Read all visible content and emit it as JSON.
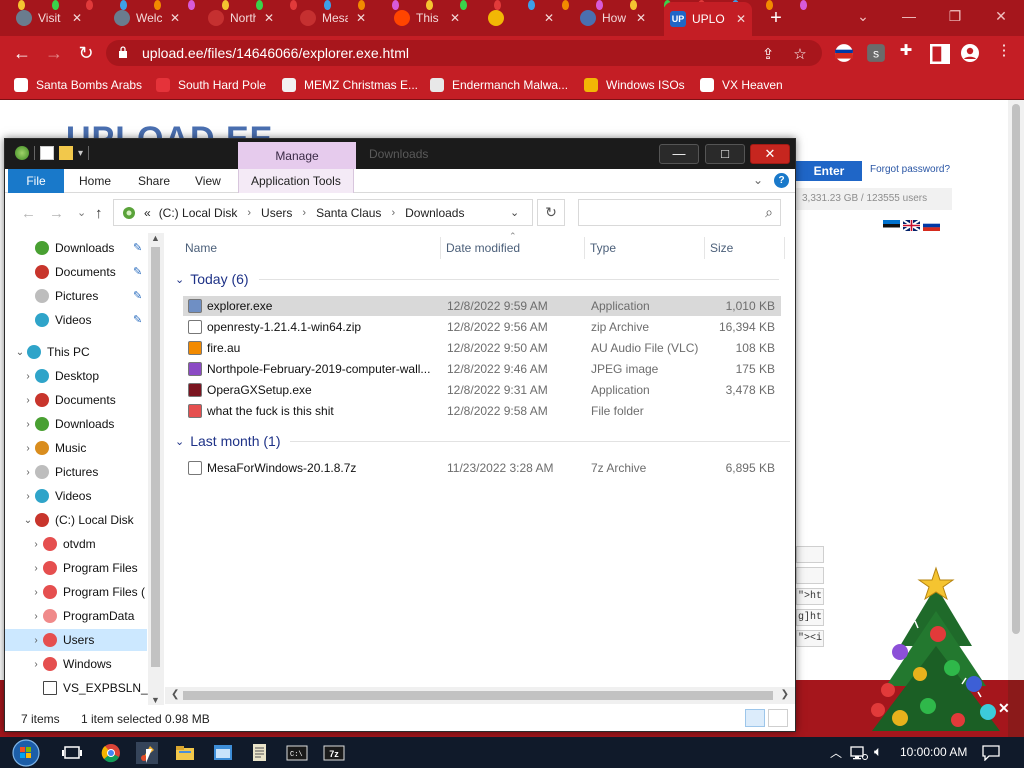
{
  "browser": {
    "tabs": [
      {
        "label": "Visit",
        "color": "#6a7c8e"
      },
      {
        "label": "Welc",
        "color": "#6a7c8e"
      },
      {
        "label": "North",
        "color": "#c53030"
      },
      {
        "label": "Mesa",
        "color": "#c53030"
      },
      {
        "label": "This",
        "color": "#ff4500"
      },
      {
        "label": "",
        "color": "#f2b705"
      },
      {
        "label": "How",
        "color": "#4a6fb0"
      },
      {
        "label": "UPLO",
        "color": "#1f66c7",
        "icon": "UP",
        "active": true
      }
    ],
    "url": "upload.ee/files/14646066/explorer.exe.html",
    "bookmarks": [
      {
        "label": "Santa Bombs Arabs",
        "color": "#ffffff"
      },
      {
        "label": "South Hard Pole",
        "color": "#e5333a"
      },
      {
        "label": "MEMZ Christmas E...",
        "color": "#f2f2f2"
      },
      {
        "label": "Endermanch Malwa...",
        "color": "#e8e8e8"
      },
      {
        "label": "Windows ISOs",
        "color": "#f2b705"
      },
      {
        "label": "VX Heaven",
        "color": "#ffffff"
      }
    ]
  },
  "webpage": {
    "logo": "UPLOAD.EE",
    "enter": "Enter",
    "forgot": "Forgot password?",
    "stats": "3,331.23 GB  /  123555 users",
    "codes": [
      "",
      "",
      "\">htt",
      "g]http",
      "\"><i"
    ]
  },
  "explorer": {
    "title": "Downloads",
    "manage": "Manage",
    "ribbon_tabs": [
      "File",
      "Home",
      "Share",
      "View",
      "Application Tools"
    ],
    "breadcrumb": [
      "(C:) Local Disk",
      "Users",
      "Santa Claus",
      "Downloads"
    ],
    "breadcrumb_lead": "«",
    "search_placeholder": "",
    "columns": {
      "name": "Name",
      "date": "Date modified",
      "type": "Type",
      "size": "Size"
    },
    "nav": [
      {
        "label": "Downloads",
        "indent": 1,
        "color": "#49a032",
        "pin": true
      },
      {
        "label": "Documents",
        "indent": 1,
        "color": "#c8352c",
        "pin": true
      },
      {
        "label": "Pictures",
        "indent": 1,
        "color": "#bdbdbd",
        "pin": true
      },
      {
        "label": "Videos",
        "indent": 1,
        "color": "#2fa4c9",
        "pin": true
      },
      {
        "label": "This PC",
        "indent": 0,
        "color": "#2fa4c9",
        "expanded": true,
        "gap": true
      },
      {
        "label": "Desktop",
        "indent": 1,
        "color": "#2fa4c9",
        "arrow": true
      },
      {
        "label": "Documents",
        "indent": 1,
        "color": "#c8352c",
        "arrow": true
      },
      {
        "label": "Downloads",
        "indent": 1,
        "color": "#49a032",
        "arrow": true
      },
      {
        "label": "Music",
        "indent": 1,
        "color": "#d98d1e",
        "arrow": true
      },
      {
        "label": "Pictures",
        "indent": 1,
        "color": "#bdbdbd",
        "arrow": true
      },
      {
        "label": "Videos",
        "indent": 1,
        "color": "#2fa4c9",
        "arrow": true
      },
      {
        "label": "(C:) Local Disk",
        "indent": 1,
        "color": "#c8352c",
        "expanded": true
      },
      {
        "label": "otvdm",
        "indent": 2,
        "color": "#e54f4f",
        "arrow": true
      },
      {
        "label": "Program Files",
        "indent": 2,
        "color": "#e54f4f",
        "arrow": true
      },
      {
        "label": "Program Files (",
        "indent": 2,
        "color": "#e54f4f",
        "arrow": true
      },
      {
        "label": "ProgramData",
        "indent": 2,
        "color": "#f08a8a",
        "arrow": true
      },
      {
        "label": "Users",
        "indent": 2,
        "color": "#e54f4f",
        "arrow": true,
        "selected": true
      },
      {
        "label": "Windows",
        "indent": 2,
        "color": "#e54f4f",
        "arrow": true
      },
      {
        "label": "VS_EXPBSLN_x",
        "indent": 2,
        "color": "#ffffff",
        "square": true
      }
    ],
    "groups": [
      {
        "label": "Today (6)",
        "files": [
          {
            "name": "explorer.exe",
            "date": "12/8/2022 9:59 AM",
            "type": "Application",
            "size": "1,010 KB",
            "color": "#6f8fc4",
            "selected": true
          },
          {
            "name": "openresty-1.21.4.1-win64.zip",
            "date": "12/8/2022 9:56 AM",
            "type": "zip Archive",
            "size": "16,394 KB",
            "color": "#ffffff"
          },
          {
            "name": "fire.au",
            "date": "12/8/2022 9:50 AM",
            "type": "AU Audio File (VLC)",
            "size": "108 KB",
            "color": "#f28a00"
          },
          {
            "name": "Northpole-February-2019-computer-wall...",
            "date": "12/8/2022 9:46 AM",
            "type": "JPEG image",
            "size": "175 KB",
            "color": "#8b4ac4"
          },
          {
            "name": "OperaGXSetup.exe",
            "date": "12/8/2022 9:31 AM",
            "type": "Application",
            "size": "3,478 KB",
            "color": "#7a1420"
          },
          {
            "name": "what the fuck is this shit",
            "date": "12/8/2022 9:58 AM",
            "type": "File folder",
            "size": "",
            "color": "#e54f4f"
          }
        ]
      },
      {
        "label": "Last month (1)",
        "files": [
          {
            "name": "MesaForWindows-20.1.8.7z",
            "date": "11/23/2022 3:28 AM",
            "type": "7z Archive",
            "size": "6,895 KB",
            "color": "#ffffff"
          }
        ]
      }
    ],
    "status_items": "7 items",
    "status_selected": "1 item selected  0.98 MB"
  },
  "taskbar": {
    "clock": "10:00:00 AM"
  }
}
